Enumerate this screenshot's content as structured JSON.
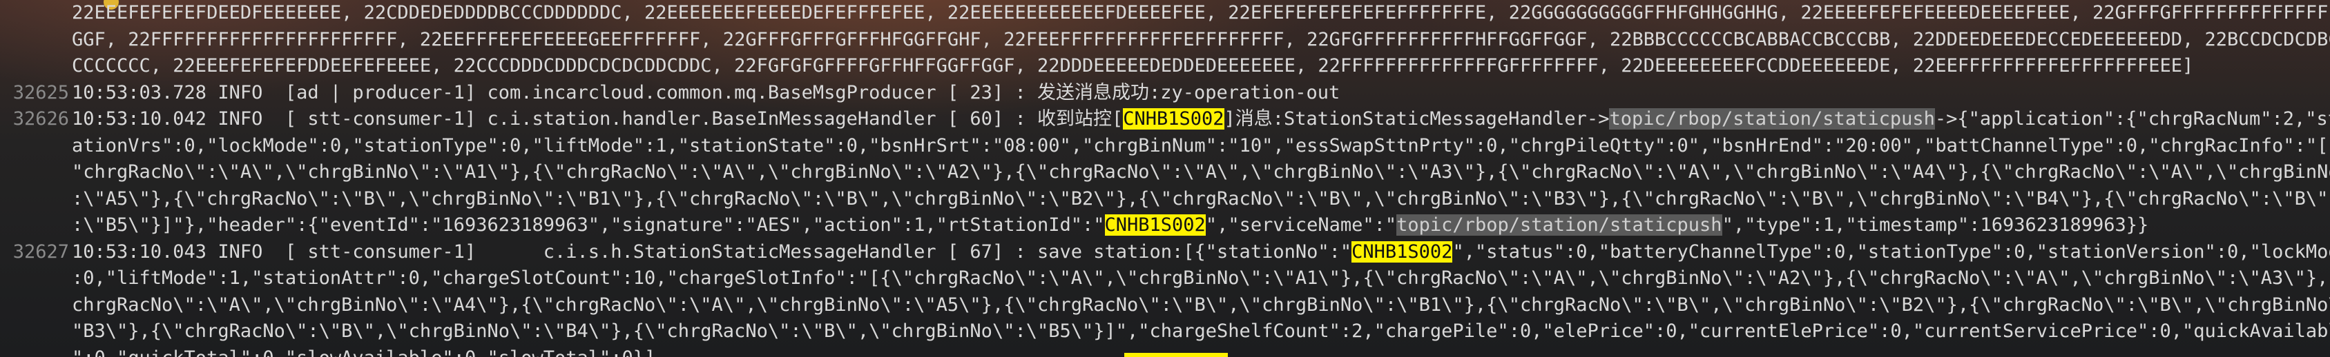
{
  "lines": [
    {
      "num": "",
      "segs": [
        {
          "t": "22EEEFEFEFEFDEEDFEEEEEEE, 22CDDEDEDDDDBCCCDDDDDDC, 22EEEEEEEFEEEEDEFEFFFEFEE, 22EEEEEEEEEEEEFDEEEEFEE, 22EFEFEFEFEFEFEFFFFFFFE, 22GGGGGGGGGGFFHFGHHGGHHG, 22EEEEFEFEFEEEEDEEEEFEEE, 22GFFFGFFFFFFFFFFFFFFFFF"
        }
      ]
    },
    {
      "num": "",
      "segs": [
        {
          "t": "GGF, 22FFFFFFFFFFFFFFFFFFFFFF, 22EEFFFEFEFEEEEGEEFFFFFFF, 22GFFFGFFFGFFFHFGGFFGHF, 22FEEFFFFFFFFFFFEFFFFFFFF, 22GFGFFFFFFFFFFHFFGGFFGGF, 22BBBCCCCCCBCABBACCBCCCBB, 22DDEEDEEEDECCEDEEEEEEDD, 22BCCDCDCDBCBCBBC"
        }
      ]
    },
    {
      "num": "",
      "segs": [
        {
          "t": "CCCCCCC, 22EEEFEFEFEFDDEEFEFEEEE, 22CCCDDDCDDDCDCDCDDCDDC, 22FGFGFGFFFFGFFHFFGGFFGGF, 22DDDEEEEEDEDDEDEEEEEEE, 22FFFFFFFFFFFFFFGFFFFFFFF, 22DEEEEEEEEFCCDDEEEEEEDE, 22EEFFFFFFFFFEFFFFFFFEEE]"
        }
      ]
    },
    {
      "num": "32625",
      "segs": [
        {
          "t": "10:53:03.728 INFO  [ad | producer-1] com.incarcloud.common.mq.BaseMsgProducer [ 23] : 发送消息成功:zy-operation-out"
        }
      ]
    },
    {
      "num": "32626",
      "segs": [
        {
          "t": "10:53:10.042 INFO  [ stt-consumer-1] c.i.station.handler.BaseInMessageHandler [ 60] : 收到站控["
        },
        {
          "t": "CNHB1S002",
          "h": "hl-yellow"
        },
        {
          "t": "]消息:StationStaticMessageHandler->"
        },
        {
          "t": "topic/rbop/station/staticpush",
          "h": "hl-gray"
        },
        {
          "t": "->{\"application\":{\"chrgRacNum\":2,\"st"
        }
      ]
    },
    {
      "num": "",
      "segs": [
        {
          "t": "ationVrs\":0,\"lockMode\":0,\"stationType\":0,\"liftMode\":1,\"stationState\":0,\"bsnHrSrt\":\"08:00\",\"chrgBinNum\":\"10\",\"essSwapSttnPrty\":0,\"chrgPileQtty\":0\",\"bsnHrEnd\":\"20:00\",\"battChannelType\":0,\"chrgRacInfo\":\"[{\\"
        }
      ]
    },
    {
      "num": "",
      "segs": [
        {
          "t": "\"chrgRacNo\\\":\\\"A\\\",\\\"chrgBinNo\\\":\\\"A1\\\"},{\\\"chrgRacNo\\\":\\\"A\\\",\\\"chrgBinNo\\\":\\\"A2\\\"},{\\\"chrgRacNo\\\":\\\"A\\\",\\\"chrgBinNo\\\":\\\"A3\\\"},{\\\"chrgRacNo\\\":\\\"A\\\",\\\"chrgBinNo\\\":\\\"A4\\\"},{\\\"chrgRacNo\\\":\\\"A\\\",\\\"chrgBinNo\\\""
        }
      ]
    },
    {
      "num": "",
      "segs": [
        {
          "t": ":\\\"A5\\\"},{\\\"chrgRacNo\\\":\\\"B\\\",\\\"chrgBinNo\\\":\\\"B1\\\"},{\\\"chrgRacNo\\\":\\\"B\\\",\\\"chrgBinNo\\\":\\\"B2\\\"},{\\\"chrgRacNo\\\":\\\"B\\\",\\\"chrgBinNo\\\":\\\"B3\\\"},{\\\"chrgRacNo\\\":\\\"B\\\",\\\"chrgBinNo\\\":\\\"B4\\\"},{\\\"chrgRacNo\\\":\\\"B\\\",\\\"c"
        }
      ]
    },
    {
      "num": "",
      "segs": [
        {
          "t": ":\\\"B5\\\"}]\"},\"header\":{\"eventId\":\"1693623189963\",\"signature\":\"AES\",\"action\":1,\"rtStationId\":\""
        },
        {
          "t": "CNHB1S002",
          "h": "hl-yellow"
        },
        {
          "t": "\",\"serviceName\":\""
        },
        {
          "t": "topic/rbop/station/staticpush",
          "h": "hl-gray"
        },
        {
          "t": "\",\"type\":1,\"timestamp\":1693623189963}}"
        }
      ]
    },
    {
      "num": "32627",
      "segs": [
        {
          "t": "10:53:10.043 INFO  [ stt-consumer-1]      c.i.s.h.StationStaticMessageHandler [ 67] : save station:[{\"stationNo\":\""
        },
        {
          "t": "CNHB1S002",
          "h": "hl-yellow"
        },
        {
          "t": "\",\"status\":0,\"batteryChannelType\":0,\"stationType\":0,\"stationVersion\":0,\"lockMode\""
        }
      ]
    },
    {
      "num": "",
      "segs": [
        {
          "t": ":0,\"liftMode\":1,\"stationAttr\":0,\"chargeSlotCount\":10,\"chargeSlotInfo\":\"[{\\\"chrgRacNo\\\":\\\"A\\\",\\\"chrgBinNo\\\":\\\"A1\\\"},{\\\"chrgRacNo\\\":\\\"A\\\",\\\"chrgBinNo\\\":\\\"A2\\\"},{\\\"chrgRacNo\\\":\\\"A\\\",\\\"chrgBinNo\\\":\\\"A3\\\"},{\\"
        }
      ]
    },
    {
      "num": "",
      "segs": [
        {
          "t": "chrgRacNo\\\":\\\"A\\\",\\\"chrgBinNo\\\":\\\"A4\\\"},{\\\"chrgRacNo\\\":\\\"A\\\",\\\"chrgBinNo\\\":\\\"A5\\\"},{\\\"chrgRacNo\\\":\\\"B\\\",\\\"chrgBinNo\\\":\\\"B1\\\"},{\\\"chrgRacNo\\\":\\\"B\\\",\\\"chrgBinNo\\\":\\\"B2\\\"},{\\\"chrgRacNo\\\":\\\"B\\\",\\\"chrgBinNo\\\":\\"
        }
      ]
    },
    {
      "num": "",
      "segs": [
        {
          "t": "\"B3\\\"},{\\\"chrgRacNo\\\":\\\"B\\\",\\\"chrgBinNo\\\":\\\"B4\\\"},{\\\"chrgRacNo\\\":\\\"B\\\",\\\"chrgBinNo\\\":\\\"B5\\\"}]\",\"chargeShelfCount\":2,\"chargePile\":0,\"elePrice\":0,\"currentElePrice\":0,\"currentServicePrice\":0,\"quickAvailable"
        }
      ]
    },
    {
      "num": "",
      "segs": [
        {
          "t": "\":0,\"quickTotal\":0,\"slowAvailable\":0,\"slowTotal\":0}]"
        }
      ]
    }
  ]
}
